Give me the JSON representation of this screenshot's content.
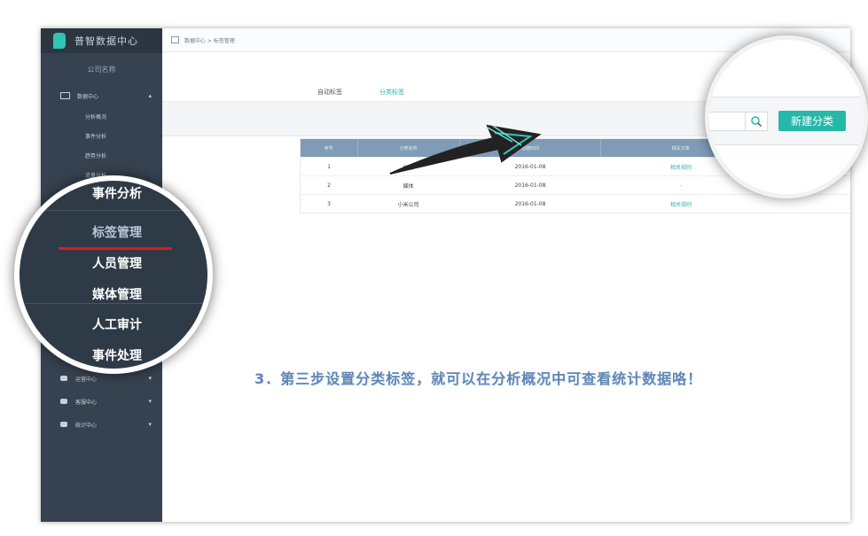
{
  "app": {
    "title": "普智数据中心",
    "company": "公司名称"
  },
  "sidebar": {
    "group": "数据中心",
    "subitems": [
      "分析概况",
      "事件分析",
      "趋势分析",
      "流量分析"
    ],
    "bottom_groups": [
      "运营中心",
      "客服中心",
      "统计中心"
    ]
  },
  "breadcrumb": "数据中心 > 标签管理",
  "tabs": [
    "自动标签",
    "分类标签"
  ],
  "table": {
    "headers": [
      "序号",
      "分类名称",
      "创建时间",
      "相关文章"
    ],
    "rows": [
      {
        "no": "1",
        "name": "公司",
        "date": "2016-01-08",
        "related": "相关规则"
      },
      {
        "no": "2",
        "name": "媒体",
        "date": "2016-01-08",
        "related": "-"
      },
      {
        "no": "3",
        "name": "小米公司",
        "date": "2016-01-08",
        "related": "相关规则"
      }
    ]
  },
  "zoom_left": {
    "items": [
      "事件分析",
      "标签管理",
      "人员管理",
      "媒体管理",
      "人工审计",
      "事件处理"
    ]
  },
  "zoom_right": {
    "button": "新建分类"
  },
  "annotation": "3．第三步设置分类标签，就可以在分析概况中可查看统计数据咯！",
  "colors": {
    "accent": "#25b8a8",
    "sidebar": "#36424f",
    "highlight": "#d81d1d",
    "annotation": "#5f86b6"
  }
}
